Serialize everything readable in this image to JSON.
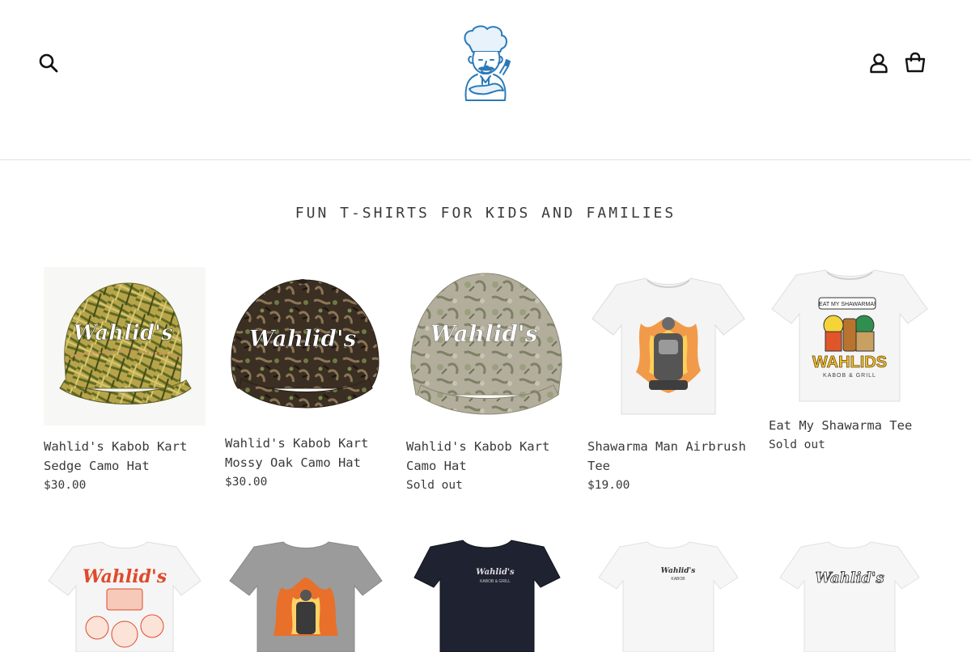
{
  "header": {
    "search_icon": "search-icon",
    "account_icon": "account-icon",
    "cart_icon": "cart-icon",
    "logo": "chef-mascot-logo"
  },
  "collection": {
    "title": "FUN T-SHIRTS FOR KIDS AND FAMILIES"
  },
  "products": [
    {
      "name_line1": "Wahlid's Kabob Kart",
      "name_line2": "Sedge Camo Hat",
      "price": "$30.00"
    },
    {
      "name_line1": "Wahlid's Kabob Kart",
      "name_line2": "Mossy Oak Camo Hat",
      "price": "$30.00"
    },
    {
      "name_line1": "Wahlid's Kabob Kart",
      "name_line2": "Camo Hat",
      "price": "Sold out"
    },
    {
      "name_line1": "Shawarma Man Airbrush",
      "name_line2": "Tee",
      "price": "$19.00"
    },
    {
      "name_line1": "Eat My Shawarma Tee",
      "name_line2": "",
      "price": "Sold out"
    }
  ],
  "artwork": {
    "hat_text": "Wahlid's",
    "tee5_banner": "EAT MY SHAWARMA!",
    "tee5_brand": "WAHLIDS",
    "tee5_sub": "KABOB & GRILL",
    "tee6_brand": "Wahlid's",
    "tee8_brand": "Wahlid's",
    "tee8_sub": "KABOB & GRILL",
    "tee9_sub": "KABOB",
    "tee10_brand": "Wahlid's"
  },
  "colors": {
    "text": "#3a3a3a",
    "logo_blue": "#2b7ab8",
    "divider": "#e3e3e3"
  }
}
